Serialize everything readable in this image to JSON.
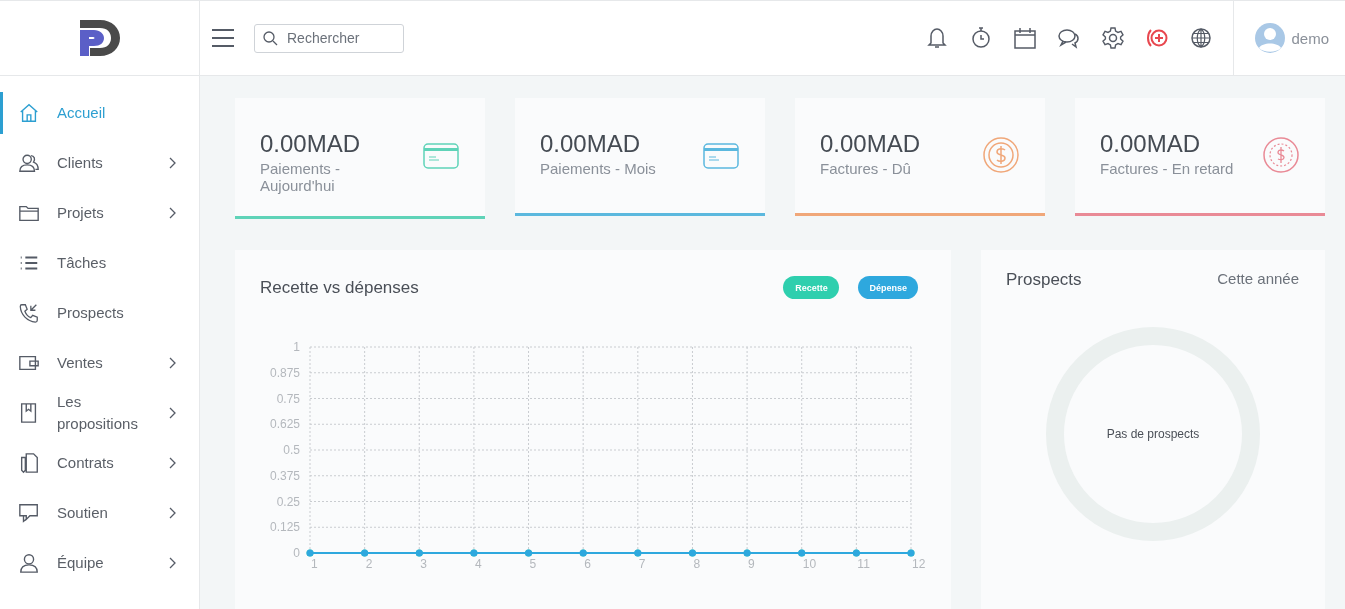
{
  "header": {
    "search": {
      "placeholder": "Rechercher"
    },
    "user": {
      "name": "demo"
    }
  },
  "sidebar": {
    "items": [
      {
        "label": "Accueil",
        "selected": true,
        "submenu": false
      },
      {
        "label": "Clients",
        "selected": false,
        "submenu": true
      },
      {
        "label": "Projets",
        "selected": false,
        "submenu": true
      },
      {
        "label": "Tâches",
        "selected": false,
        "submenu": false
      },
      {
        "label": "Prospects",
        "selected": false,
        "submenu": false
      },
      {
        "label": "Ventes",
        "selected": false,
        "submenu": true
      },
      {
        "label": "Les propositions",
        "selected": false,
        "submenu": true
      },
      {
        "label": "Contrats",
        "selected": false,
        "submenu": true
      },
      {
        "label": "Soutien",
        "selected": false,
        "submenu": true
      },
      {
        "label": "Équipe",
        "selected": false,
        "submenu": true
      }
    ]
  },
  "stats": [
    {
      "value": "0.00MAD",
      "label": "Paiements - Aujourd'hui",
      "kind": "card",
      "color": "#5fd3b8"
    },
    {
      "value": "0.00MAD",
      "label": "Paiements - Mois",
      "kind": "card",
      "color": "#5bb8de"
    },
    {
      "value": "0.00MAD",
      "label": "Factures - Dû",
      "kind": "coin",
      "color": "#f0a779"
    },
    {
      "value": "0.00MAD",
      "label": "Factures - En retard",
      "kind": "coin-dashed",
      "color": "#e98a96"
    }
  ],
  "revenue_chart": {
    "title": "Recette vs dépenses",
    "chart_data": {
      "type": "line",
      "categories": [
        "1",
        "2",
        "3",
        "4",
        "5",
        "6",
        "7",
        "8",
        "9",
        "10",
        "11",
        "12"
      ],
      "series": [
        {
          "name": "Recette",
          "color": "#2ecfae",
          "marker": true,
          "values": [
            0,
            0,
            0,
            0,
            0,
            0,
            0,
            0,
            0,
            0,
            0,
            0
          ]
        },
        {
          "name": "Dépense",
          "color": "#2ea8de",
          "marker": true,
          "values": [
            0,
            0,
            0,
            0,
            0,
            0,
            0,
            0,
            0,
            0,
            0,
            0
          ]
        }
      ],
      "grid": true,
      "ylim": [
        0,
        1
      ],
      "yticks": [
        0,
        0.125,
        0.25,
        0.375,
        0.5,
        0.625,
        0.75,
        0.875,
        1
      ]
    }
  },
  "prospects": {
    "title": "Prospects",
    "period": "Cette année",
    "empty_text": "Pas de prospects"
  }
}
